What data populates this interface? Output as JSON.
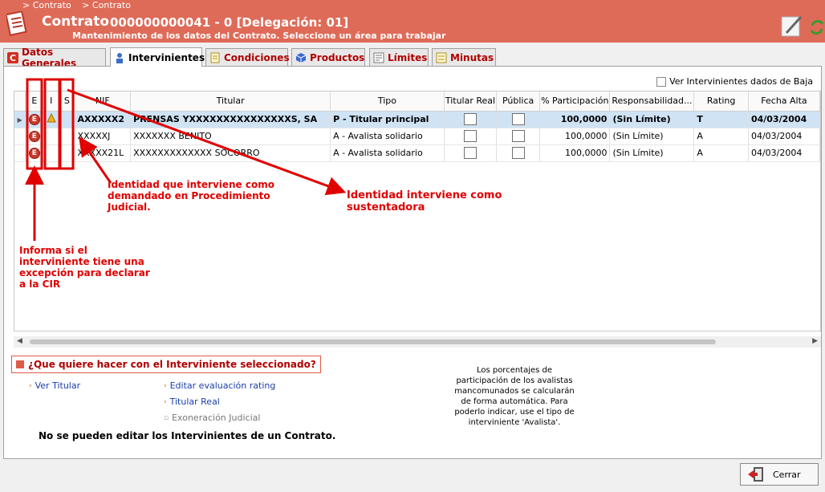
{
  "header": {
    "crumbs": [
      "> Contrato",
      "> Contrato"
    ],
    "title": "Contrato",
    "code": "000000000041 - 0 [Delegación: 01]",
    "subtitle": "Mantenimiento de los datos del Contrato. Seleccione un área para trabajar",
    "accent_color": "#de6b58"
  },
  "tabs": [
    {
      "label": "Datos Generales",
      "icon": "contract-c-icon"
    },
    {
      "label": "Intervinientes",
      "icon": "person-icon"
    },
    {
      "label": "Condiciones",
      "icon": "document-icon"
    },
    {
      "label": "Productos",
      "icon": "cube-icon"
    },
    {
      "label": "Límites",
      "icon": "limits-icon"
    },
    {
      "label": "Minutas",
      "icon": "minutes-icon"
    }
  ],
  "filter": {
    "ver_baja_label": "Ver Intervinientes dados de Baja"
  },
  "grid": {
    "columns": [
      "E",
      "I",
      "S",
      "NIF",
      "Titular",
      "Tipo",
      "Titular Real",
      "Pública",
      "% Participación",
      "Responsabilidad...",
      "Rating",
      "Fecha Alta"
    ],
    "rows": [
      {
        "e": "E",
        "warn": true,
        "nif": "AXXXXX2",
        "titular": "PRENSAS YXXXXXXXXXXXXXXXS, SA",
        "tipo": "P - Titular principal",
        "participacion": "100,0000",
        "responsabilidad": "(Sin Límite)",
        "rating": "T",
        "fecha": "04/03/2004",
        "selected": true
      },
      {
        "e": "E",
        "warn": false,
        "nif": "XXXXXJ",
        "titular": "XXXXXXX BENITO",
        "tipo": "A - Avalista solidario",
        "participacion": "100,0000",
        "responsabilidad": "(Sin Límite)",
        "rating": "A",
        "fecha": "04/03/2004",
        "selected": false
      },
      {
        "e": "E",
        "warn": false,
        "nif": "XXXXX21L",
        "titular": "XXXXXXXXXXXXX SOCORRO",
        "tipo": "A - Avalista solidario",
        "participacion": "100,0000",
        "responsabilidad": "(Sin Límite)",
        "rating": "A",
        "fecha": "04/03/2004",
        "selected": false
      }
    ]
  },
  "annotations": {
    "demandado": "Identidad que interviene como demandado en Procedimiento Judicial.",
    "sustentadora": "Identidad interviene como sustentadora",
    "excepcion": "Informa si el interviniente tiene una excepción para declarar a la CIR"
  },
  "actions": {
    "title": "¿Que quiere hacer con el Interviniente seleccionado?",
    "ver_titular": "Ver Titular",
    "editar_rating": "Editar evaluación rating",
    "titular_real": "Titular Real",
    "exoneracion": "Exoneración Judicial",
    "note": "Los porcentajes de participación de los avalistas mancomunados se calcularán de forma automática. Para poderlo indicar, use el tipo de interviniente 'Avalista'.",
    "warning": "No se pueden editar los Intervinientes de un Contrato."
  },
  "footer": {
    "close_label": "Cerrar"
  }
}
